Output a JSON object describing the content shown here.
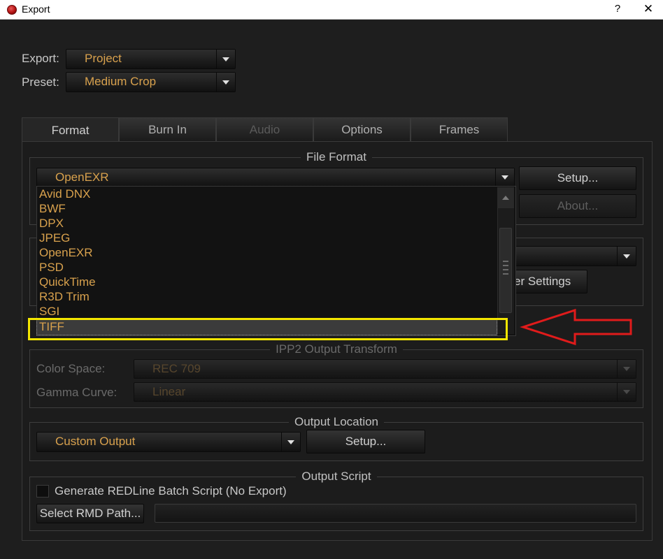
{
  "window": {
    "title": "Export",
    "help": "?",
    "close": "✕"
  },
  "export_row": {
    "label": "Export:",
    "value": "Project"
  },
  "preset_row": {
    "label": "Preset:",
    "value": "Medium Crop"
  },
  "tabs": [
    {
      "label": "Format",
      "state": "active"
    },
    {
      "label": "Burn In",
      "state": "normal"
    },
    {
      "label": "Audio",
      "state": "disabled"
    },
    {
      "label": "Options",
      "state": "normal"
    },
    {
      "label": "Frames",
      "state": "normal"
    }
  ],
  "file_format": {
    "title": "File Format",
    "selected": "OpenEXR",
    "setup_button": "Setup...",
    "about_button": "About...",
    "options": [
      "Avid DNX",
      "BWF",
      "DPX",
      "JPEG",
      "OpenEXR",
      "PSD",
      "QuickTime",
      "R3D Trim",
      "SGI",
      "TIFF"
    ],
    "highlighted": "TIFF"
  },
  "hidden_section": {
    "settings_button": "er Settings"
  },
  "ipp2": {
    "title": "IPP2 Output Transform",
    "color_space_label": "Color Space:",
    "color_space_value": "REC 709",
    "gamma_label": "Gamma Curve:",
    "gamma_value": "Linear"
  },
  "output_location": {
    "title": "Output Location",
    "value": "Custom Output",
    "setup_button": "Setup..."
  },
  "output_script": {
    "title": "Output Script",
    "checkbox_label": "Generate REDLine Batch Script (No Export)",
    "select_button": "Select RMD Path...",
    "path_value": ""
  },
  "colors": {
    "accent_text": "#d8a14d",
    "highlight_box": "#f3e600",
    "annotation_arrow": "#e01b1b"
  }
}
